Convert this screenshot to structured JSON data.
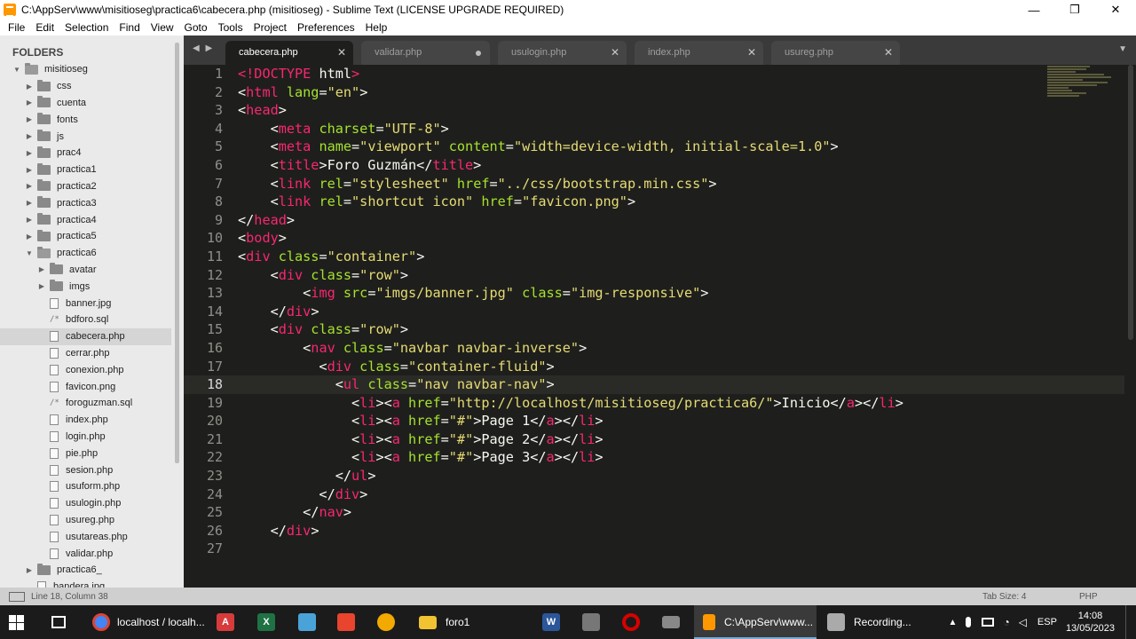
{
  "window": {
    "title": "C:\\AppServ\\www\\misitioseg\\practica6\\cabecera.php (misitioseg) - Sublime Text (LICENSE UPGRADE REQUIRED)",
    "minimize": "—",
    "maximize": "❐",
    "close": "✕"
  },
  "menu": [
    "File",
    "Edit",
    "Selection",
    "Find",
    "View",
    "Goto",
    "Tools",
    "Project",
    "Preferences",
    "Help"
  ],
  "sidebar": {
    "header": "FOLDERS",
    "items": [
      {
        "label": "misitioseg",
        "kind": "folder-open",
        "depth": 0,
        "arrow": "▼"
      },
      {
        "label": "css",
        "kind": "folder",
        "depth": 1,
        "arrow": "▶"
      },
      {
        "label": "cuenta",
        "kind": "folder",
        "depth": 1,
        "arrow": "▶"
      },
      {
        "label": "fonts",
        "kind": "folder",
        "depth": 1,
        "arrow": "▶"
      },
      {
        "label": "js",
        "kind": "folder",
        "depth": 1,
        "arrow": "▶"
      },
      {
        "label": "prac4",
        "kind": "folder",
        "depth": 1,
        "arrow": "▶"
      },
      {
        "label": "practica1",
        "kind": "folder",
        "depth": 1,
        "arrow": "▶"
      },
      {
        "label": "practica2",
        "kind": "folder",
        "depth": 1,
        "arrow": "▶"
      },
      {
        "label": "practica3",
        "kind": "folder",
        "depth": 1,
        "arrow": "▶"
      },
      {
        "label": "practica4",
        "kind": "folder",
        "depth": 1,
        "arrow": "▶"
      },
      {
        "label": "practica5",
        "kind": "folder",
        "depth": 1,
        "arrow": "▶"
      },
      {
        "label": "practica6",
        "kind": "folder-open",
        "depth": 1,
        "arrow": "▼"
      },
      {
        "label": "avatar",
        "kind": "folder",
        "depth": 2,
        "arrow": "▶"
      },
      {
        "label": "imgs",
        "kind": "folder",
        "depth": 2,
        "arrow": "▶"
      },
      {
        "label": "banner.jpg",
        "kind": "file",
        "depth": 2
      },
      {
        "label": "bdforo.sql",
        "kind": "sql",
        "depth": 2
      },
      {
        "label": "cabecera.php",
        "kind": "file",
        "depth": 2,
        "selected": true
      },
      {
        "label": "cerrar.php",
        "kind": "file",
        "depth": 2
      },
      {
        "label": "conexion.php",
        "kind": "file",
        "depth": 2
      },
      {
        "label": "favicon.png",
        "kind": "file",
        "depth": 2
      },
      {
        "label": "foroguzman.sql",
        "kind": "sql",
        "depth": 2
      },
      {
        "label": "index.php",
        "kind": "file",
        "depth": 2
      },
      {
        "label": "login.php",
        "kind": "file",
        "depth": 2
      },
      {
        "label": "pie.php",
        "kind": "file",
        "depth": 2
      },
      {
        "label": "sesion.php",
        "kind": "file",
        "depth": 2
      },
      {
        "label": "usuform.php",
        "kind": "file",
        "depth": 2
      },
      {
        "label": "usulogin.php",
        "kind": "file",
        "depth": 2
      },
      {
        "label": "usureg.php",
        "kind": "file",
        "depth": 2
      },
      {
        "label": "usutareas.php",
        "kind": "file",
        "depth": 2
      },
      {
        "label": "validar.php",
        "kind": "file",
        "depth": 2
      },
      {
        "label": "practica6_",
        "kind": "folder",
        "depth": 1,
        "arrow": "▶"
      },
      {
        "label": "bandera.jpg",
        "kind": "file",
        "depth": 1
      }
    ]
  },
  "tabs": [
    {
      "label": "cabecera.php",
      "active": true,
      "close": "✕"
    },
    {
      "label": "validar.php",
      "dirty": true
    },
    {
      "label": "usulogin.php",
      "close": "✕"
    },
    {
      "label": "index.php",
      "close": "✕"
    },
    {
      "label": "usureg.php",
      "close": "✕"
    }
  ],
  "tab_nav": "◀ ▶",
  "tab_menu": "▼",
  "editor": {
    "current_line": 18,
    "lines": [
      [
        [
          "t",
          "<!"
        ],
        [
          "t",
          "DOCTYPE "
        ],
        [
          "m",
          "html"
        ],
        [
          "t",
          ">"
        ]
      ],
      [
        [
          "m",
          "<"
        ],
        [
          "t",
          "html "
        ],
        [
          "a",
          "lang"
        ],
        [
          "m",
          "="
        ],
        [
          "s",
          "\"en\""
        ],
        [
          "m",
          ">"
        ]
      ],
      [
        [
          "m",
          "<"
        ],
        [
          "t",
          "head"
        ],
        [
          "m",
          ">"
        ]
      ],
      [
        [
          "m",
          "    <"
        ],
        [
          "t",
          "meta "
        ],
        [
          "a",
          "charset"
        ],
        [
          "m",
          "="
        ],
        [
          "s",
          "\"UTF-8\""
        ],
        [
          "m",
          ">"
        ]
      ],
      [
        [
          "m",
          "    <"
        ],
        [
          "t",
          "meta "
        ],
        [
          "a",
          "name"
        ],
        [
          "m",
          "="
        ],
        [
          "s",
          "\"viewport\" "
        ],
        [
          "a",
          "content"
        ],
        [
          "m",
          "="
        ],
        [
          "s",
          "\"width=device-width, initial-scale=1.0\""
        ],
        [
          "m",
          ">"
        ]
      ],
      [
        [
          "m",
          "    <"
        ],
        [
          "t",
          "title"
        ],
        [
          "m",
          ">Foro Guzmán</"
        ],
        [
          "t",
          "title"
        ],
        [
          "m",
          ">"
        ]
      ],
      [
        [
          "m",
          "    <"
        ],
        [
          "t",
          "link "
        ],
        [
          "a",
          "rel"
        ],
        [
          "m",
          "="
        ],
        [
          "s",
          "\"stylesheet\" "
        ],
        [
          "a",
          "href"
        ],
        [
          "m",
          "="
        ],
        [
          "s",
          "\"../css/bootstrap.min.css\""
        ],
        [
          "m",
          ">"
        ]
      ],
      [
        [
          "m",
          "    <"
        ],
        [
          "t",
          "link "
        ],
        [
          "a",
          "rel"
        ],
        [
          "m",
          "="
        ],
        [
          "s",
          "\"shortcut icon\" "
        ],
        [
          "a",
          "href"
        ],
        [
          "m",
          "="
        ],
        [
          "s",
          "\"favicon.png\""
        ],
        [
          "m",
          ">"
        ]
      ],
      [
        [
          "m",
          "</"
        ],
        [
          "t",
          "head"
        ],
        [
          "m",
          ">"
        ]
      ],
      [
        [
          "m",
          "<"
        ],
        [
          "t",
          "body"
        ],
        [
          "m",
          ">"
        ]
      ],
      [
        [
          "m",
          "<"
        ],
        [
          "t",
          "div "
        ],
        [
          "a",
          "class"
        ],
        [
          "m",
          "="
        ],
        [
          "s",
          "\"container\""
        ],
        [
          "m",
          ">"
        ]
      ],
      [
        [
          "m",
          "    <"
        ],
        [
          "t",
          "div "
        ],
        [
          "a",
          "class"
        ],
        [
          "m",
          "="
        ],
        [
          "s",
          "\"row\""
        ],
        [
          "m",
          ">"
        ]
      ],
      [
        [
          "m",
          "        <"
        ],
        [
          "t",
          "img "
        ],
        [
          "a",
          "src"
        ],
        [
          "m",
          "="
        ],
        [
          "s",
          "\"imgs/banner.jpg\" "
        ],
        [
          "a",
          "class"
        ],
        [
          "m",
          "="
        ],
        [
          "s",
          "\"img-responsive\""
        ],
        [
          "m",
          ">"
        ]
      ],
      [
        [
          "m",
          "    </"
        ],
        [
          "t",
          "div"
        ],
        [
          "m",
          ">"
        ]
      ],
      [
        [
          "m",
          "    <"
        ],
        [
          "t",
          "div "
        ],
        [
          "a",
          "class"
        ],
        [
          "m",
          "="
        ],
        [
          "s",
          "\"row\""
        ],
        [
          "m",
          ">"
        ]
      ],
      [
        [
          "m",
          "        <"
        ],
        [
          "t",
          "nav "
        ],
        [
          "a",
          "class"
        ],
        [
          "m",
          "="
        ],
        [
          "s",
          "\"navbar navbar-inverse\""
        ],
        [
          "m",
          ">"
        ]
      ],
      [
        [
          "m",
          "          <"
        ],
        [
          "t",
          "div "
        ],
        [
          "a",
          "class"
        ],
        [
          "m",
          "="
        ],
        [
          "s",
          "\"container-fluid\""
        ],
        [
          "m",
          ">"
        ]
      ],
      [
        [
          "m",
          "            <"
        ],
        [
          "t",
          "ul "
        ],
        [
          "a",
          "class"
        ],
        [
          "m",
          "="
        ],
        [
          "s",
          "\"nav navbar-nav\""
        ],
        [
          "m",
          ">"
        ]
      ],
      [
        [
          "m",
          "              <"
        ],
        [
          "t",
          "li"
        ],
        [
          "m",
          "><"
        ],
        [
          "t",
          "a "
        ],
        [
          "a",
          "href"
        ],
        [
          "m",
          "="
        ],
        [
          "s",
          "\"http://localhost/misitioseg/practica6/\""
        ],
        [
          "m",
          ">Inicio</"
        ],
        [
          "t",
          "a"
        ],
        [
          "m",
          "></"
        ],
        [
          "t",
          "li"
        ],
        [
          "m",
          ">"
        ]
      ],
      [
        [
          "m",
          "              <"
        ],
        [
          "t",
          "li"
        ],
        [
          "m",
          "><"
        ],
        [
          "t",
          "a "
        ],
        [
          "a",
          "href"
        ],
        [
          "m",
          "="
        ],
        [
          "s",
          "\"#\""
        ],
        [
          "m",
          ">Page 1</"
        ],
        [
          "t",
          "a"
        ],
        [
          "m",
          "></"
        ],
        [
          "t",
          "li"
        ],
        [
          "m",
          ">"
        ]
      ],
      [
        [
          "m",
          "              <"
        ],
        [
          "t",
          "li"
        ],
        [
          "m",
          "><"
        ],
        [
          "t",
          "a "
        ],
        [
          "a",
          "href"
        ],
        [
          "m",
          "="
        ],
        [
          "s",
          "\"#\""
        ],
        [
          "m",
          ">Page 2</"
        ],
        [
          "t",
          "a"
        ],
        [
          "m",
          "></"
        ],
        [
          "t",
          "li"
        ],
        [
          "m",
          ">"
        ]
      ],
      [
        [
          "m",
          "              <"
        ],
        [
          "t",
          "li"
        ],
        [
          "m",
          "><"
        ],
        [
          "t",
          "a "
        ],
        [
          "a",
          "href"
        ],
        [
          "m",
          "="
        ],
        [
          "s",
          "\"#\""
        ],
        [
          "m",
          ">Page 3</"
        ],
        [
          "t",
          "a"
        ],
        [
          "m",
          "></"
        ],
        [
          "t",
          "li"
        ],
        [
          "m",
          ">"
        ]
      ],
      [
        [
          "m",
          "            </"
        ],
        [
          "t",
          "ul"
        ],
        [
          "m",
          ">"
        ]
      ],
      [
        [
          "m",
          "          </"
        ],
        [
          "t",
          "div"
        ],
        [
          "m",
          ">"
        ]
      ],
      [
        [
          "m",
          "        </"
        ],
        [
          "t",
          "nav"
        ],
        [
          "m",
          ">"
        ]
      ],
      [
        [
          "m",
          "    </"
        ],
        [
          "t",
          "div"
        ],
        [
          "m",
          ">"
        ]
      ],
      []
    ]
  },
  "status": {
    "position": "Line 18, Column 38",
    "tab_size": "Tab Size: 4",
    "syntax": "PHP"
  },
  "taskbar": {
    "items": [
      {
        "label": "",
        "icon": "windows-start-icon"
      },
      {
        "label": "",
        "icon": "task-view-icon"
      },
      {
        "label": "localhost / localh...",
        "icon": "chrome-icon",
        "color": "#4285f4"
      },
      {
        "label": "",
        "icon": "acrobat-icon",
        "color": "#d83b3b"
      },
      {
        "label": "",
        "icon": "excel-icon",
        "color": "#1f7244"
      },
      {
        "label": "",
        "icon": "notepad-icon",
        "color": "#4aa3d8"
      },
      {
        "label": "",
        "icon": "app-red-icon",
        "color": "#e8442e"
      },
      {
        "label": "",
        "icon": "app-yellow-icon",
        "color": "#f2a900"
      },
      {
        "label": "foro1",
        "icon": "folder-icon",
        "color": "#f1c232"
      },
      {
        "label": "",
        "icon": "word-icon",
        "color": "#2b579a"
      },
      {
        "label": "",
        "icon": "calculator-icon",
        "color": "#777777"
      },
      {
        "label": "",
        "icon": "opera-icon",
        "color": "#d90000"
      },
      {
        "label": "",
        "icon": "app-window-icon",
        "color": "#888888"
      },
      {
        "label": "C:\\AppServ\\www...",
        "icon": "sublime-icon",
        "color": "#ff9800",
        "active": true
      },
      {
        "label": "Recording...",
        "icon": "recording-icon",
        "color": "#aaaaaa"
      }
    ],
    "tray": {
      "language": "ESP",
      "time": "14:08",
      "date": "13/05/2023"
    }
  }
}
